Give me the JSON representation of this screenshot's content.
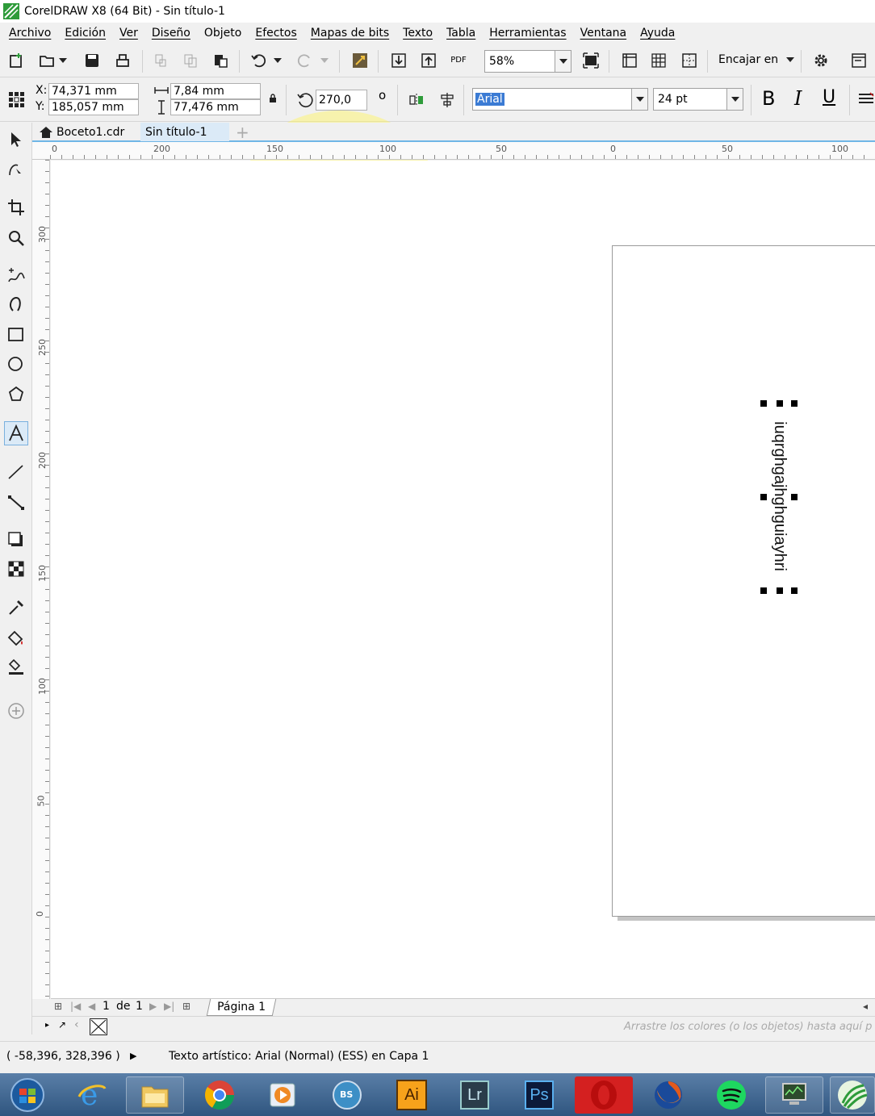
{
  "window": {
    "title": "CorelDRAW X8 (64 Bit) - Sin título-1"
  },
  "menu": [
    "Archivo",
    "Edición",
    "Ver",
    "Diseño",
    "Objeto",
    "Efectos",
    "Mapas de bits",
    "Texto",
    "Tabla",
    "Herramientas",
    "Ventana",
    "Ayuda"
  ],
  "standard_toolbar": {
    "zoom": "58%",
    "snap_label": "Encajar en",
    "pdf_label": "PDF"
  },
  "property_bar": {
    "x_label": "X:",
    "x_value": "74,371 mm",
    "y_label": "Y:",
    "y_value": "185,057 mm",
    "width_value": "7,84 mm",
    "height_value": "77,476 mm",
    "rotation_value": "270,0",
    "rotation_unit": "o",
    "font_name": "Arial",
    "font_size": "24 pt",
    "bold_label": "B",
    "italic_label": "I",
    "underline_label": "U"
  },
  "doc_tabs": [
    {
      "label": "Boceto1.cdr"
    },
    {
      "label": "Sin título-1"
    }
  ],
  "ruler": {
    "h_ticks": [
      "0",
      "200",
      "150",
      "100",
      "50",
      "0",
      "50",
      "100"
    ],
    "v_ticks": [
      "300",
      "250",
      "200",
      "150",
      "100",
      "50",
      "0"
    ]
  },
  "canvas": {
    "text_object": "iuqrghgajhghguiayhri"
  },
  "page_nav": {
    "current": "1",
    "of_label": "de",
    "total": "1",
    "page_tab": "Página 1"
  },
  "color_bar": {
    "hint": "Arrastre los colores (o los objetos) hasta aquí p"
  },
  "status_bar": {
    "coords": "( -58,396, 328,396 )",
    "object_info": "Texto artístico: Arial (Normal) (ESS) en Capa 1"
  },
  "taskbar": {
    "apps": [
      "start",
      "internet-explorer",
      "file-explorer",
      "chrome",
      "media-player",
      "bs-player",
      "illustrator",
      "lightroom",
      "photoshop",
      "opera",
      "firefox",
      "spotify",
      "network-monitor",
      "coreldraw"
    ],
    "ai_label": "Ai",
    "lr_label": "Lr",
    "ps_label": "Ps",
    "bs_label": "BS"
  },
  "colors": {
    "highlight": "#fff55a",
    "tab_accent": "#6fb6e6",
    "corel_green": "#2e9b3a"
  }
}
